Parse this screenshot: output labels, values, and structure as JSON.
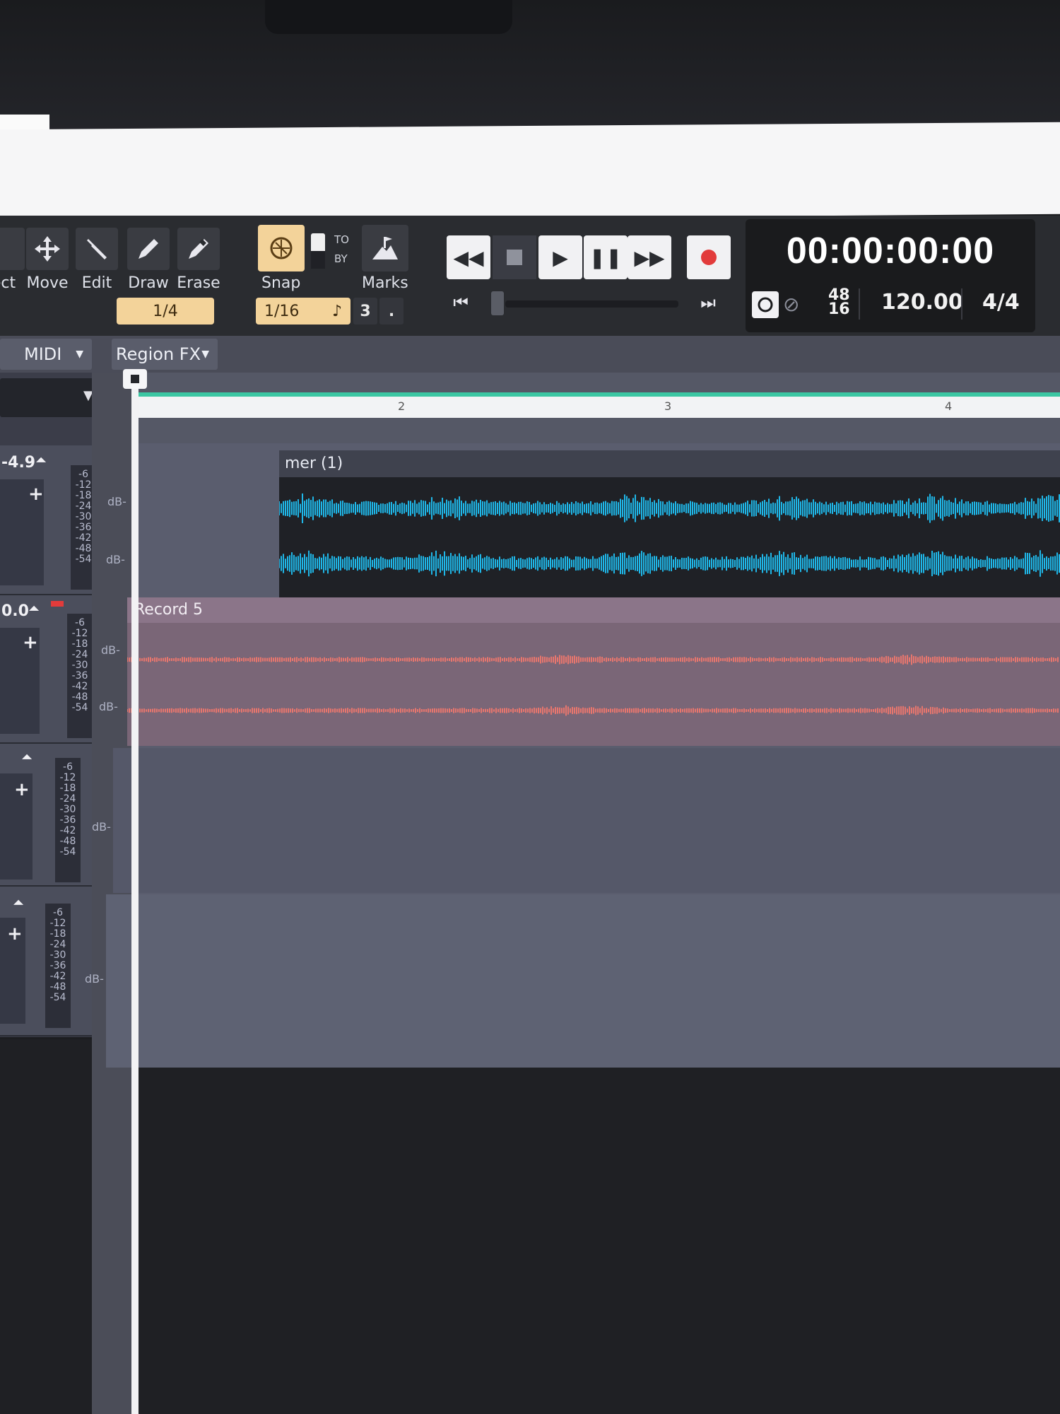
{
  "toolbar": {
    "tools": [
      {
        "label": "ect",
        "icon": "select-icon"
      },
      {
        "label": "Move",
        "icon": "move-icon"
      },
      {
        "label": "Edit",
        "icon": "wrench-icon"
      },
      {
        "label": "Draw",
        "icon": "pencil-icon"
      },
      {
        "label": "Erase",
        "icon": "eraser-icon"
      }
    ],
    "tool_value": "1/4",
    "snap_label": "Snap",
    "snap_to": "TO",
    "snap_by": "BY",
    "snap_value": "1/16",
    "snap_count": "3",
    "snap_dot": ".",
    "marks_label": "Marks"
  },
  "transport": {
    "time": "00:00:00:00",
    "tempo": "120.00",
    "meter": "4/4",
    "sample_rate_top": "48",
    "sample_rate_bottom": "16"
  },
  "subbar": {
    "midi_label": "MIDI",
    "region_fx_label": "Region FX"
  },
  "ruler": {
    "ticks": [
      "2",
      "3",
      "4"
    ]
  },
  "tracks": [
    {
      "volume": "-4.9",
      "clip_title": "mer (1)",
      "color": "#1fb7e8"
    },
    {
      "volume": "0.0",
      "clip_title": "Record 5",
      "color": "#e7766e"
    },
    {
      "volume": "",
      "clip_title": ""
    },
    {
      "volume": "",
      "clip_title": ""
    }
  ],
  "meter_scale": [
    "-6",
    "-12",
    "-18",
    "-24",
    "-30",
    "-36",
    "-42",
    "-48",
    "-54"
  ],
  "db_label": "dB-",
  "colors": {
    "accent_snap": "#f3d39a",
    "ruler_loop": "#3cc7a3",
    "record": "#e23b3b"
  }
}
